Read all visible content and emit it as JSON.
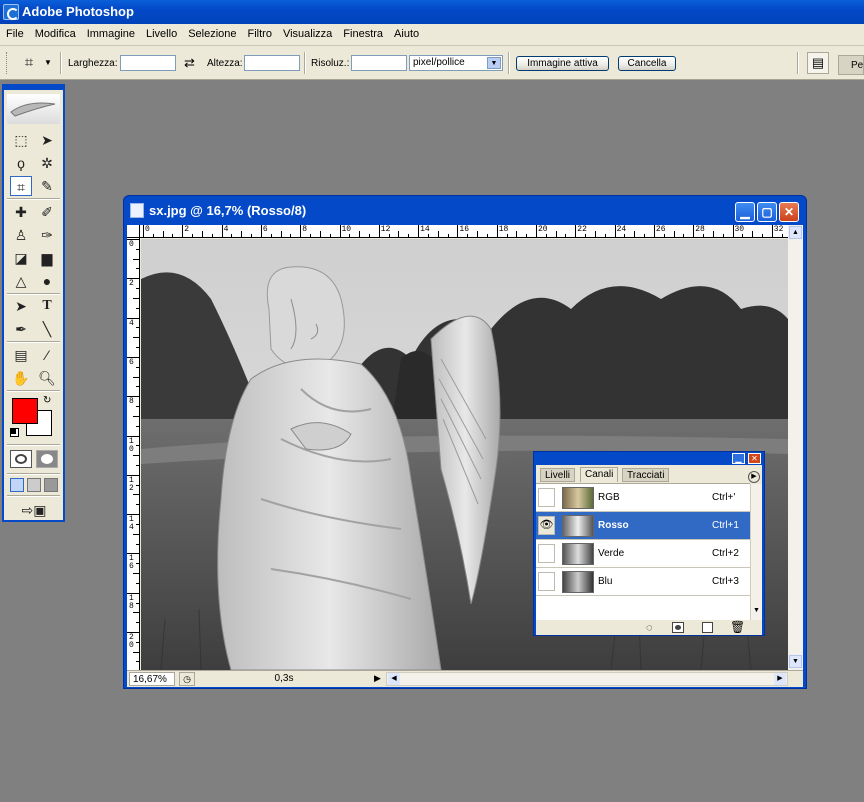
{
  "app": {
    "title": "Adobe Photoshop"
  },
  "menu": [
    "File",
    "Modifica",
    "Immagine",
    "Livello",
    "Selezione",
    "Filtro",
    "Visualizza",
    "Finestra",
    "Aiuto"
  ],
  "options": {
    "width_label": "Larghezza:",
    "height_label": "Altezza:",
    "resolution_label": "Risoluz.:",
    "unit_value": "pixel/pollice",
    "front_image_button": "Immagine attiva",
    "clear_button": "Cancella",
    "palette_tab": "Pe"
  },
  "document": {
    "title": "sx.jpg @ 16,7% (Rosso/8)",
    "zoom": "16,67%",
    "status_info": "0,3s",
    "hruler_labels": [
      "0",
      "2",
      "4",
      "6",
      "8",
      "10",
      "12",
      "14",
      "16",
      "18",
      "20",
      "22",
      "24",
      "26",
      "28",
      "30",
      "32"
    ],
    "vruler_labels": [
      "0",
      "2",
      "4",
      "6",
      "8",
      "10",
      "12",
      "14",
      "16",
      "18",
      "20"
    ]
  },
  "panel": {
    "tabs": [
      "Livelli",
      "Canali",
      "Tracciati"
    ],
    "active_tab": "Canali",
    "channels": [
      {
        "name": "RGB",
        "shortcut": "Ctrl+'",
        "visible": false,
        "selected": false
      },
      {
        "name": "Rosso",
        "shortcut": "Ctrl+1",
        "visible": true,
        "selected": true
      },
      {
        "name": "Verde",
        "shortcut": "Ctrl+2",
        "visible": false,
        "selected": false
      },
      {
        "name": "Blu",
        "shortcut": "Ctrl+3",
        "visible": false,
        "selected": false
      }
    ]
  },
  "colors": {
    "foreground": "#ff0000",
    "background": "#ffffff",
    "titlebar": "#0349c8",
    "selection": "#316ac5"
  }
}
